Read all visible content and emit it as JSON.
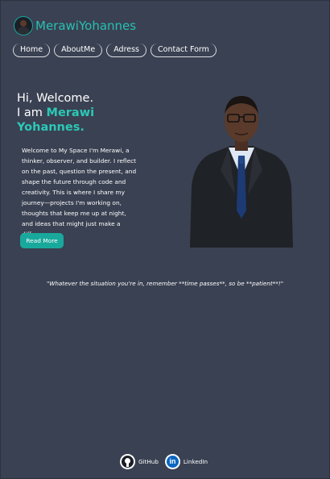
{
  "brand": {
    "name": "MerawiYohannes"
  },
  "nav": [
    {
      "label": "Home"
    },
    {
      "label": "AboutMe"
    },
    {
      "label": "Adress"
    },
    {
      "label": "Contact Form"
    }
  ],
  "hero": {
    "greeting_line1": "Hi, Welcome.",
    "greeting_prefix": "I am ",
    "greeting_name_line1": "Merawi",
    "greeting_name_line2": "Yohannes.",
    "intro": "Welcome to My Space I'm Merawi, a thinker, observer, and builder. I reflect on the past, question the present, and shape the future through code and creativity. This is where I share my journey—projects I'm working on, thoughts that keep me up at night, and ideas that might just make a difference.",
    "read_more_label": "Read More"
  },
  "quote": "\"Whatever the situation you're in, remember **time passes**, so be **patient**!\"",
  "footer": {
    "links": [
      {
        "label": "GitHub",
        "icon": "github-icon"
      },
      {
        "label": "LinkedIn",
        "icon": "linkedin-icon"
      }
    ]
  },
  "colors": {
    "background": "#3a4152",
    "accent": "#2cc8b7",
    "button": "#19a99c"
  }
}
